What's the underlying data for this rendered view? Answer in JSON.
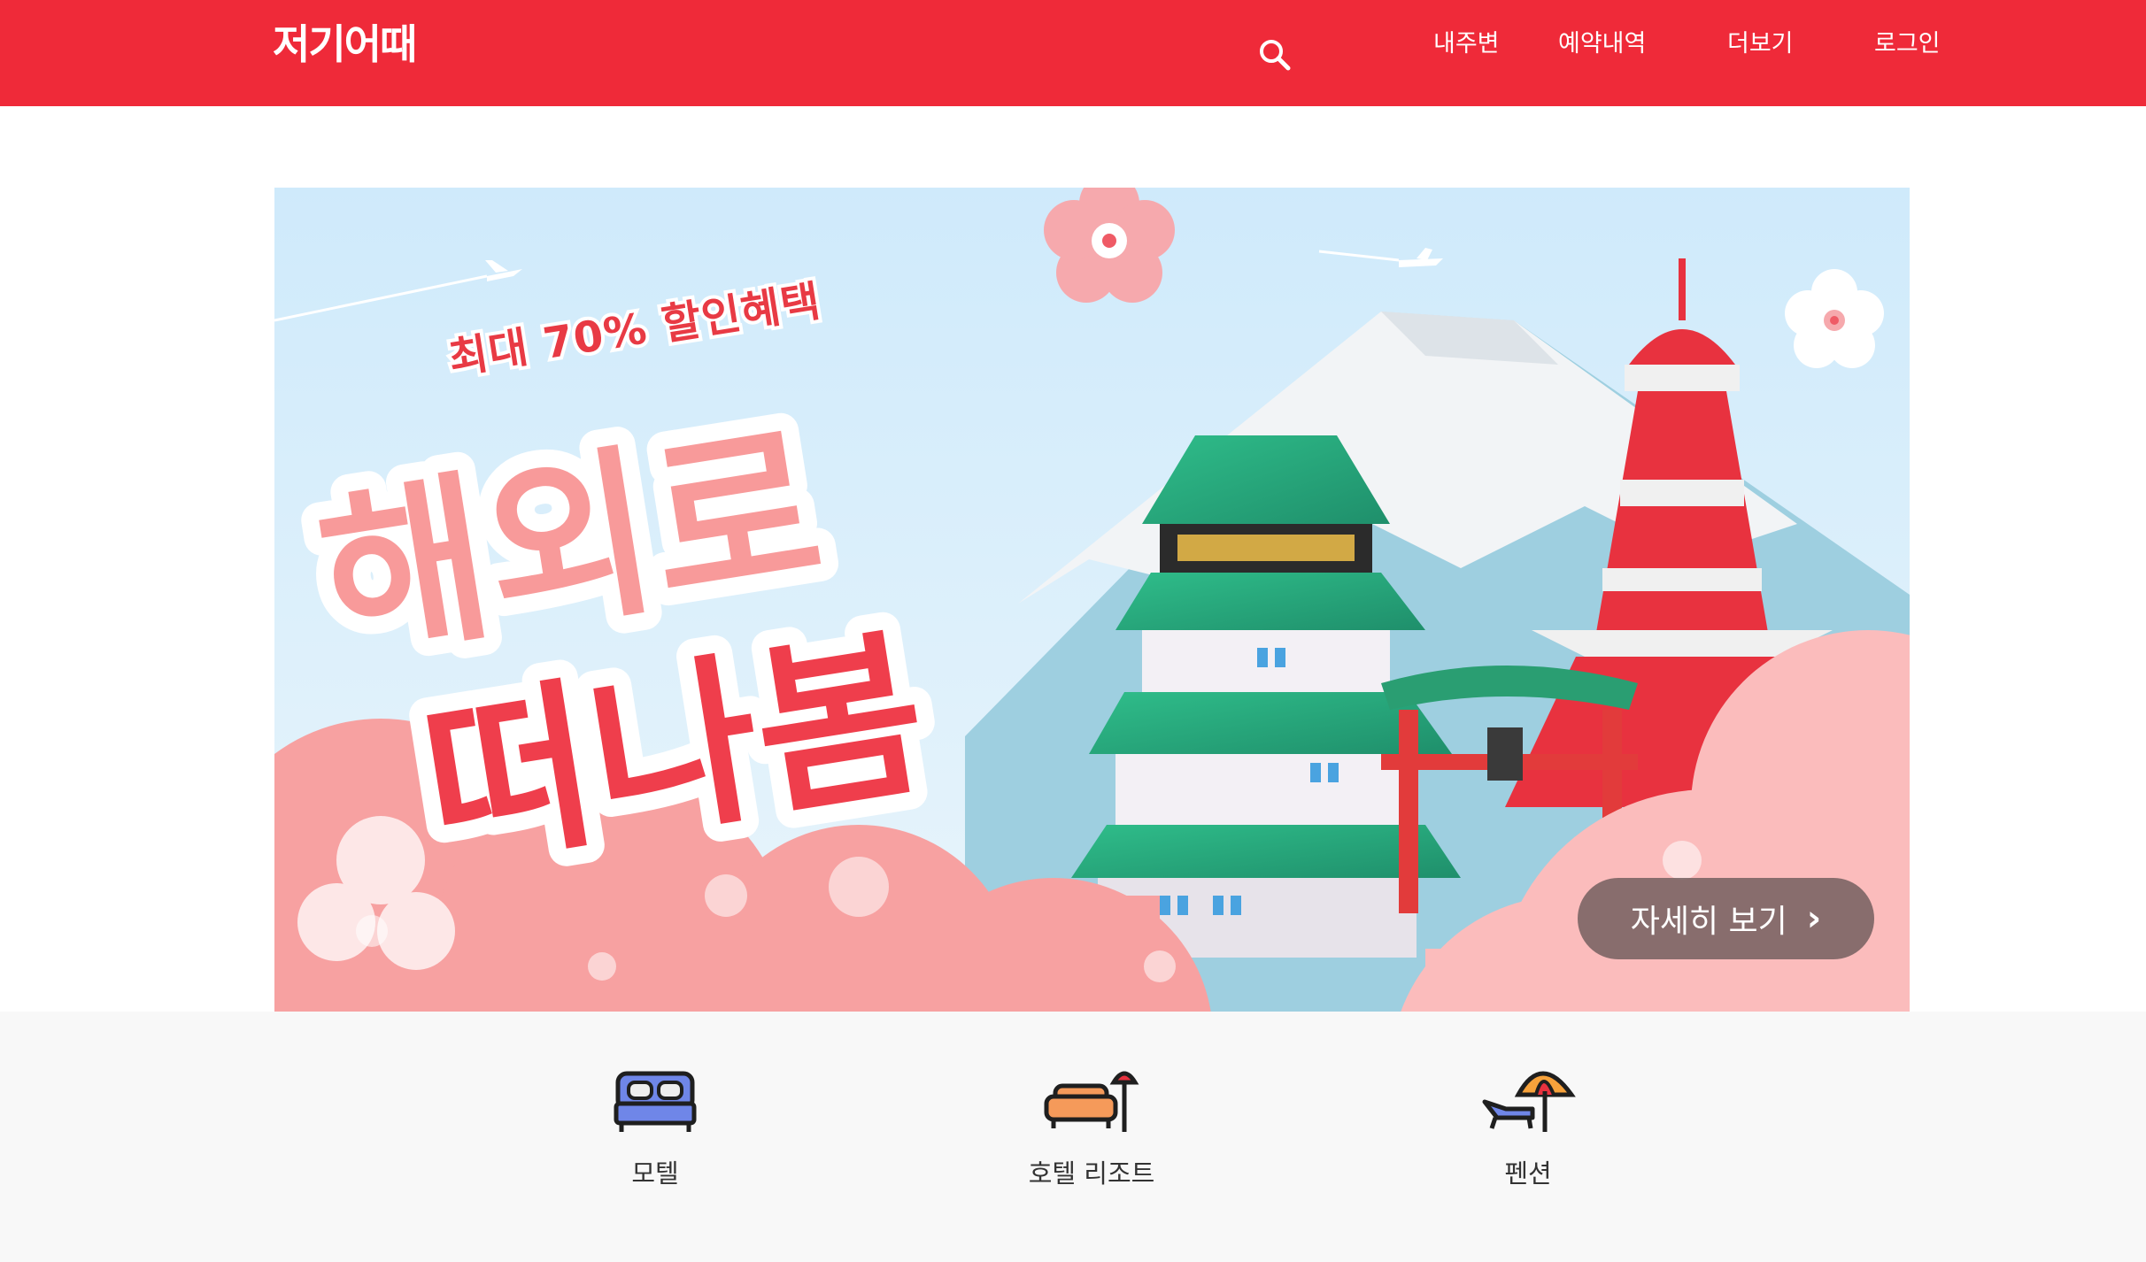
{
  "header": {
    "logo": "저기어때",
    "search_icon": "search-icon",
    "nav": [
      {
        "label": "내주변"
      },
      {
        "label": "예약내역"
      },
      {
        "label": "더보기"
      },
      {
        "label": "로그인"
      }
    ]
  },
  "banner": {
    "tagline": "최대 70% 할인혜택",
    "headline_line1": "해외로",
    "headline_line2": "떠나봄",
    "cta_label": "자세히 보기",
    "cta_icon": "chevron-right-icon"
  },
  "categories": [
    {
      "label": "모텔",
      "icon": "bed-icon"
    },
    {
      "label": "호텔 리조트",
      "icon": "sofa-lamp-icon"
    },
    {
      "label": "펜션",
      "icon": "beach-umbrella-icon"
    }
  ],
  "colors": {
    "brand": "#ef2a39",
    "category_bg": "#f8f8f8",
    "banner_sky": "#d6eefa",
    "banner_pink": "#f8a5a5"
  }
}
